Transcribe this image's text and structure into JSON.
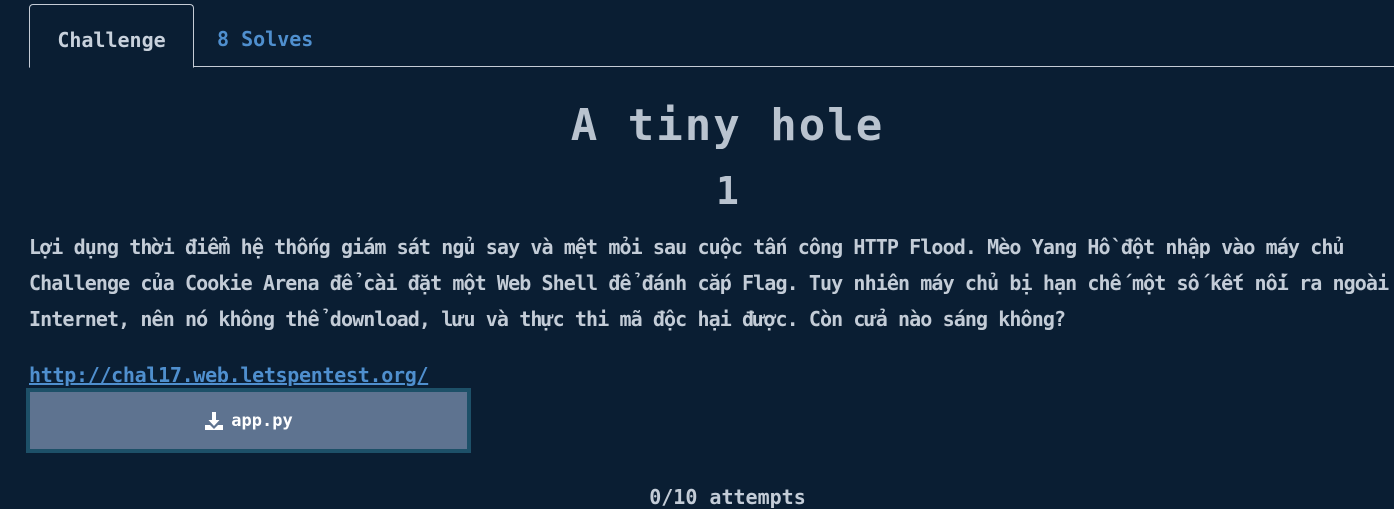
{
  "tabs": {
    "challenge": "Challenge",
    "solves": "8 Solves"
  },
  "challenge": {
    "name": "A tiny hole",
    "value": "1",
    "description": "Lợi dụng thời điểm hệ thống giám sát ngủ say và mệt mỏi sau cuộc tấn công HTTP Flood. Mèo Yang Hồ đột nhập vào máy chủ Challenge của Cookie Arena để cài đặt một Web Shell để đánh cắp Flag. Tuy nhiên máy chủ bị hạn chế một số kết nối ra ngoài Internet, nên nó không thể download, lưu và thực thi mã độc hại được. Còn cửa nào sáng không?",
    "link": "http://chal17.web.letspentest.org/",
    "file": {
      "name": "app.py",
      "icon": "download-icon"
    },
    "attempts": "0/10 attempts"
  }
}
